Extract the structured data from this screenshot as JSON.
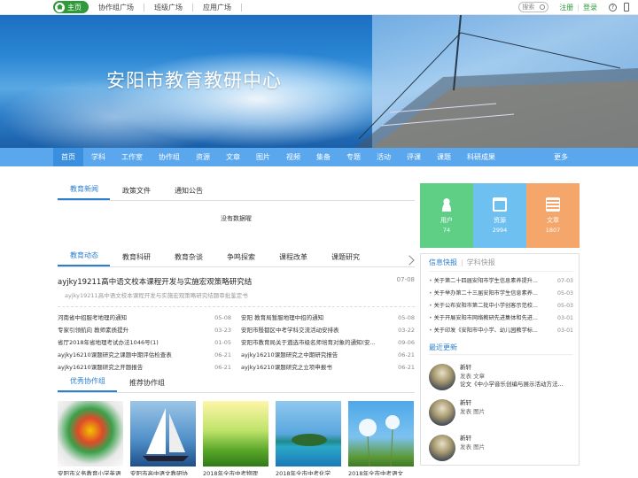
{
  "topbar": {
    "home": "主页",
    "links": [
      "协作组广场",
      "班级广场",
      "应用广场"
    ],
    "search_placeholder": "搜索",
    "register": "注册",
    "login": "登录"
  },
  "banner": {
    "title": "安阳市教育教研中心"
  },
  "nav": {
    "items": [
      "首页",
      "学科",
      "工作室",
      "协作组",
      "资源",
      "文章",
      "图片",
      "视频",
      "集备",
      "专题",
      "活动",
      "评课",
      "课题",
      "科研成果"
    ],
    "more": "更多"
  },
  "news_tabs": [
    "教育新闻",
    "政策文件",
    "通知公告"
  ],
  "no_data": "没有数据喔",
  "dynamic_tabs": [
    "教育动态",
    "教育科研",
    "教育杂谈",
    "争鸣探索",
    "课程改革",
    "课题研究"
  ],
  "headline": {
    "title": "ayjky19211高中语文校本课程开发与实施宏观策略研究结",
    "date": "07-08",
    "summary": "ayjky19211高中语文校本课程开发与实施宏观策略研究结题审批鉴定书"
  },
  "news_left": [
    {
      "t": "河南省中招服考地理的通知",
      "d": "05-08"
    },
    {
      "t": "专家引领航向 教师素质提升",
      "d": "03-23"
    },
    {
      "t": "省厅2018年省地理考试办法1046号(1)",
      "d": "01-05"
    },
    {
      "t": "ayjky16210课题研究之课题中期评估检查表",
      "d": "06-21"
    },
    {
      "t": "ayjky16210课题研究之开题报告",
      "d": "06-21"
    }
  ],
  "news_right": [
    {
      "t": "安阳 教育局暂服地理中招的通知",
      "d": "05-08"
    },
    {
      "t": "安阳市殷都区中考学科交流活动安排表",
      "d": "03-22"
    },
    {
      "t": "安阳市教育局关于遴选市级名师培育对象的通知(安...",
      "d": "09-06"
    },
    {
      "t": "ayjky16210课题研究之中期研究报告",
      "d": "06-21"
    },
    {
      "t": "ayjky16210课题研究之立项申报书",
      "d": "06-21"
    }
  ],
  "group_tabs": [
    "优秀协作组",
    "推荐协作组"
  ],
  "gallery": [
    {
      "caption": "安阳市义务教育小学英语"
    },
    {
      "caption": "安阳市高中语文教研协"
    },
    {
      "caption": "2018年全市中考物理"
    },
    {
      "caption": "2018年全市中考化学"
    },
    {
      "caption": "2018年全市中考语文"
    }
  ],
  "stats": [
    {
      "label": "用户",
      "num": "74",
      "color": "#5ecf84",
      "icon": "user-icon"
    },
    {
      "label": "资源",
      "num": "2994",
      "color": "#6ec0f0",
      "icon": "folder-icon"
    },
    {
      "label": "文章",
      "num": "1807",
      "color": "#f5a66a",
      "icon": "document-icon"
    }
  ],
  "info": {
    "tab_active": "信息快报",
    "tab_other": "学科快报",
    "items": [
      {
        "t": "关于第二十四届安阳市学生信息素养提升...",
        "d": "07-03"
      },
      {
        "t": "关于举办第二十三届安阳市学生信息素养...",
        "d": "05-03"
      },
      {
        "t": "关于公布安阳市第二批中小学创客示范校...",
        "d": "05-03"
      },
      {
        "t": "关于开展安阳市网络教研先进集体和先进...",
        "d": "03-01"
      },
      {
        "t": "关于印发《安阳市中小学、幼儿园教学标...",
        "d": "03-01"
      }
    ]
  },
  "latest": {
    "title": "最近更新",
    "items": [
      {
        "name": "新轩",
        "action": "发表 文章",
        "detail": "论文《中小学音乐创编与展示活动方法..."
      },
      {
        "name": "新轩",
        "action": "发表 图片",
        "detail": ""
      },
      {
        "name": "新轩",
        "action": "发表 图片",
        "detail": ""
      }
    ]
  }
}
